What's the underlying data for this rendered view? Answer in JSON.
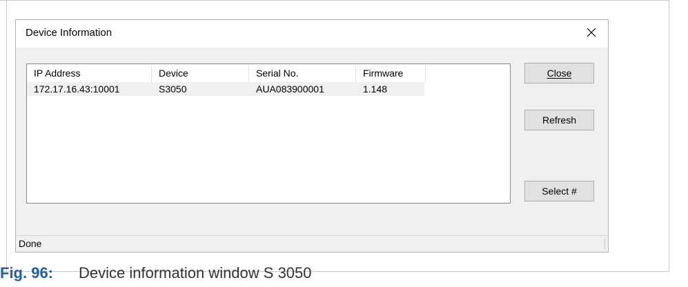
{
  "dialog": {
    "title": "Device Information",
    "columns": [
      "IP Address",
      "Device",
      "Serial No.",
      "Firmware"
    ],
    "rows": [
      [
        "172.17.16.43:10001",
        "S3050",
        "AUA083900001",
        "1.148"
      ]
    ],
    "buttons": {
      "close": "Close",
      "refresh": "Refresh",
      "select": "Select #"
    },
    "status": "Done"
  },
  "caption": {
    "label": "Fig. 96:",
    "text": "Device information window S 3050"
  },
  "colors": {
    "caption_label": "#1f5fa8",
    "dialog_background": "#f0f0f0",
    "button_face": "#e1e1e1"
  }
}
